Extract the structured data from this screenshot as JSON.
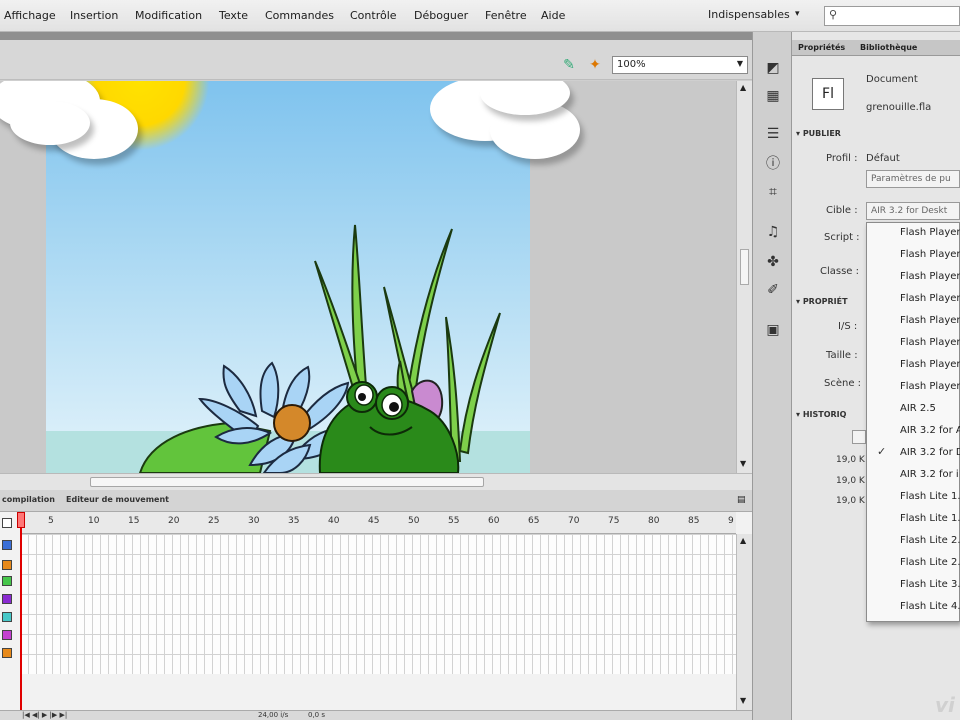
{
  "menu": {
    "items": [
      "Affichage",
      "Insertion",
      "Modification",
      "Texte",
      "Commandes",
      "Contrôle",
      "Déboguer",
      "Fenêtre",
      "Aide"
    ],
    "workspace": "Indispensables"
  },
  "toolbar": {
    "zoom": "100%"
  },
  "timeline": {
    "tabs": [
      "compilation",
      "Editeur de mouvement"
    ],
    "ruler": [
      "5",
      "10",
      "15",
      "20",
      "25",
      "30",
      "35",
      "40",
      "45",
      "50",
      "55",
      "60",
      "65",
      "70",
      "75",
      "80",
      "85",
      "9"
    ],
    "layer_colors": [
      "#3a6fd8",
      "#e88a1a",
      "#46c64a",
      "#8a2bd1",
      "#47c8c8",
      "#c43fd0",
      "#e88a1a"
    ],
    "status": {
      "fps": "24,00 i/s",
      "time": "0,0 s"
    }
  },
  "properties": {
    "tabs": [
      "Propriétés",
      "Bibliothèque"
    ],
    "doc_icon": "Fl",
    "doc_type": "Document",
    "doc_name": "grenouille.fla",
    "section_publish": "PUBLIER",
    "profile_label": "Profil :",
    "profile_value": "Défaut",
    "publish_settings": "Paramètres de pu",
    "target_label": "Cible :",
    "target_value": "AIR 3.2 for Deskt",
    "script_label": "Script :",
    "class_label": "Classe :",
    "section_props": "PROPRIÉT",
    "fps_label": "I/S :",
    "size_label": "Taille :",
    "stage_label": "Scène :",
    "section_history": "HISTORIQ",
    "history_values": [
      "19,0 K",
      "19,0 K",
      "19,0 K"
    ]
  },
  "dropdown": {
    "items": [
      "Flash Player",
      "Flash Player",
      "Flash Player",
      "Flash Player",
      "Flash Player",
      "Flash Player",
      "Flash Player",
      "Flash Player",
      "AIR 2.5",
      "AIR 3.2 for A",
      "AIR 3.2 for D",
      "AIR 3.2 for i",
      "Flash Lite 1.",
      "Flash Lite 1.",
      "Flash Lite 2.",
      "Flash Lite 2.",
      "Flash Lite 3.",
      "Flash Lite 4."
    ],
    "checked_index": 10
  }
}
